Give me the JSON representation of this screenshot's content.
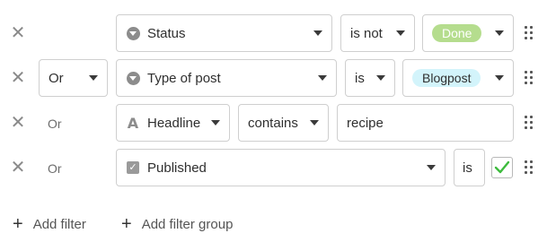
{
  "filters": [
    {
      "conjunction": "",
      "field": "Status",
      "field_icon": "single-select-icon",
      "operator": "is not",
      "value": "Done",
      "value_type": "pill",
      "value_color": "#b5dd8e"
    },
    {
      "conjunction": "Or",
      "field": "Type of post",
      "field_icon": "single-select-icon",
      "operator": "is",
      "value": "Blogpost",
      "value_type": "pill",
      "value_color": "#d3f4fb"
    },
    {
      "conjunction": "Or",
      "field": "Headline",
      "field_icon": "text-field-icon",
      "operator": "contains",
      "value": "recipe",
      "value_type": "text"
    },
    {
      "conjunction": "Or",
      "field": "Published",
      "field_icon": "boolean-field-icon",
      "operator": "is",
      "value": "checked",
      "value_type": "checkbox"
    }
  ],
  "add_filter_label": "Add filter",
  "add_filter_group_label": "Add filter group"
}
